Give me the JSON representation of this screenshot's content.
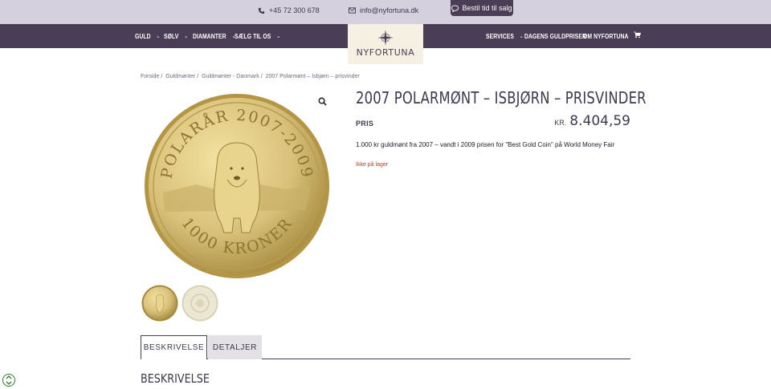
{
  "topbar": {
    "phone": "+45 72 300 678",
    "email": "info@nyfortuna.dk",
    "book_label": "Bestil tid til salg"
  },
  "nav": {
    "left": [
      "GULD",
      "SØLV",
      "DIAMANTER",
      "SÆLG TIL OS"
    ],
    "right": [
      "SERVICES",
      "DAGENS GULDPRISER",
      "OM NYFORTUNA"
    ]
  },
  "logo": {
    "text": "NYFORTUNA"
  },
  "breadcrumb": [
    "Forside",
    "Guldmønter",
    "Guldmønter - Danmark",
    "2007 Polarmønt – Isbjørn – prisvinder"
  ],
  "product": {
    "title": "2007 POLARMØNT – ISBJØRN – PRISVINDER",
    "price_label": "PRIS",
    "currency": "KR.",
    "price": "8.404,59",
    "description": "1.000 kr guldmønt fra 2007 – vandt i 2009 prisen for \"Best Gold Coin\" på World Money Fair",
    "stock": "Ikke på lager",
    "coin_text_top": "POLARÅR 2007-2009",
    "coin_text_bottom": "1000 KRONER"
  },
  "tabs": [
    "BESKRIVELSE",
    "DETALJER"
  ],
  "section_title": "BESKRIVELSE",
  "colors": {
    "brand": "#4a3e57",
    "topbar": "#d5d0de",
    "gold": "#d8c079",
    "stock": "#c0392b"
  }
}
